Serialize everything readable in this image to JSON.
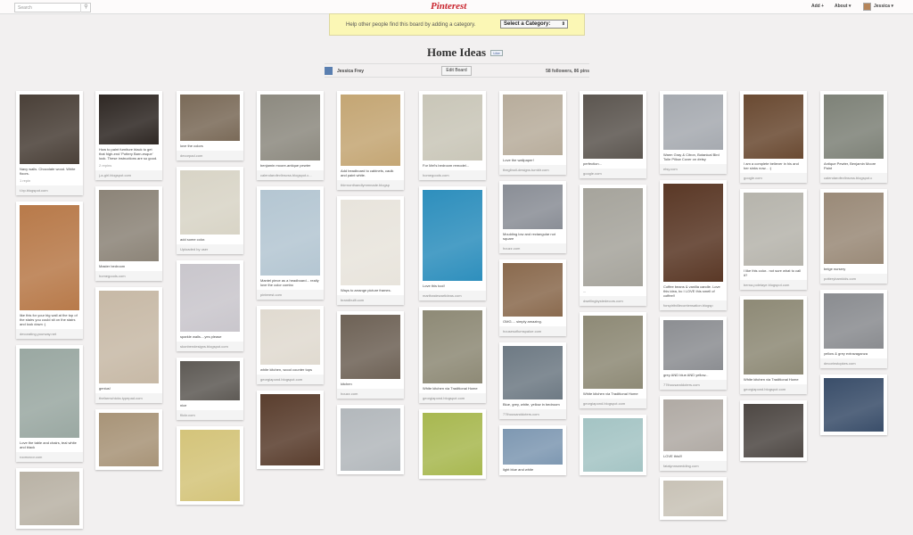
{
  "header": {
    "search_placeholder": "Search",
    "search_icon": "magnifier-icon",
    "logo": "Pinterest",
    "add_label": "Add +",
    "about_label": "About ▾",
    "user_label": "Jessica ▾"
  },
  "banner": {
    "text": "Help other people find this board by adding a category.",
    "select_value": "Select a Category:"
  },
  "board": {
    "title": "Home Ideas",
    "like_label": "Like",
    "owner": "Jessica Frey",
    "edit_label": "Edit Board",
    "stats": "58 followers, 86 pins"
  },
  "colors": {
    "brand": "#c8232c",
    "banner": "#fbf7b5"
  },
  "columns": [
    {
      "pins": [
        {
          "desc": "Navy walls. Chocolate wood. White floors.",
          "meta": "1 repin",
          "src": "t.bp.blogspot.com",
          "color": "#4a4038"
        },
        {
          "desc": "like this for your big wall at the top of the stairs you could sit on the stairs and look down :)",
          "meta": "",
          "src": "decorating.yourway.net",
          "color": "#b87a4a"
        },
        {
          "desc": "Love the table and chairs, teal white and black",
          "meta": "",
          "src": "roomzoor.com",
          "color": "#9aa8a2"
        },
        {
          "desc": "",
          "meta": "",
          "src": "",
          "color": "#b9b2a5"
        }
      ]
    },
    {
      "pins": [
        {
          "desc": "How to paint furniture black to get that high-end 'Pottery Barn-esque' look. These instructions are so good.",
          "meta": "2 repins",
          "src": "j-a-girl.blogspot.com",
          "color": "#2f2824"
        },
        {
          "desc": "Master bedroom",
          "meta": "",
          "src": "homegoods.com",
          "color": "#8c8478"
        },
        {
          "desc": "genius!",
          "meta": "",
          "src": "thefarmchicks.typepad.com",
          "color": "#c7b9a6"
        },
        {
          "desc": "",
          "meta": "",
          "src": "",
          "color": "#a89478"
        }
      ]
    },
    {
      "pins": [
        {
          "desc": "love the colors",
          "meta": "",
          "src": "decorpad.com",
          "color": "#7a6a58"
        },
        {
          "desc": "add some color.",
          "meta": "",
          "src": "Uploaded by user",
          "color": "#d8d4c6"
        },
        {
          "desc": "sparkle walls....yes please",
          "meta": "",
          "src": "skonbendesigns.blogspot.com",
          "color": "#c9c6cc"
        },
        {
          "desc": "nice",
          "meta": "",
          "src": "flickr.com",
          "color": "#5e5a55"
        },
        {
          "desc": "",
          "meta": "",
          "src": "",
          "color": "#d4c47a"
        }
      ]
    },
    {
      "pins": [
        {
          "desc": "benjamin moore-antique pewter",
          "meta": "",
          "src": "calendarofevlinsvss.blogspot.c...",
          "color": "#8d8a80"
        },
        {
          "desc": "Mantel piece as a headboard... really love the color combo",
          "meta": "",
          "src": "pinterest.com",
          "color": "#b4c6d2"
        },
        {
          "desc": "white kitchen, wood counter tops",
          "meta": "",
          "src": "georgiapond.blogspot.com",
          "color": "#e0dad0"
        },
        {
          "desc": "",
          "meta": "",
          "src": "",
          "color": "#5a3e2e"
        }
      ]
    },
    {
      "pins": [
        {
          "desc": "Add beadboard to cabinets, caulk and paint white.",
          "meta": "",
          "src": "thirrnonthandlymmnade.blogsp",
          "color": "#c4a674"
        },
        {
          "desc": "Ways to arrange picture frames.",
          "meta": "",
          "src": "brandbuilt.com",
          "color": "#e8e4dc"
        },
        {
          "desc": "kitchen",
          "meta": "",
          "src": "houzz.com",
          "color": "#6e6256"
        },
        {
          "desc": "",
          "meta": "",
          "src": "",
          "color": "#b3b8bc"
        }
      ]
    },
    {
      "pins": [
        {
          "desc": "For Mel's bedroom remodel...",
          "meta": "",
          "src": "homegoods.com",
          "color": "#c9c6b8"
        },
        {
          "desc": "Love this tool!",
          "meta": "",
          "src": "marthastewartideas.com",
          "color": "#2e8fbd"
        },
        {
          "desc": "White kitchen via Traditional Home",
          "meta": "",
          "src": "georgiapond.blogspot.com",
          "color": "#8e8a76"
        },
        {
          "desc": "",
          "meta": "",
          "src": "",
          "color": "#a8b850"
        }
      ]
    },
    {
      "pins": [
        {
          "desc": "Love the wallpaper!",
          "meta": "",
          "src": "theglinoil-designs.tumblr.com",
          "color": "#b8ad9c"
        },
        {
          "desc": "Moulding low and rectangular not square",
          "meta": "",
          "src": "houzz.com",
          "color": "#8a8e96"
        },
        {
          "desc": "OMG.... simply amazing.",
          "meta": "",
          "src": "housesoflumspaloe.com",
          "color": "#8a6a4e"
        },
        {
          "desc": "Blue, grey, white, yellow in bedroom",
          "meta": "",
          "src": "77thousanddoters.com",
          "color": "#6e7a84"
        },
        {
          "desc": "light blue and white",
          "meta": "",
          "src": "",
          "color": "#7e98b2"
        }
      ]
    },
    {
      "pins": [
        {
          "desc": "perfection...",
          "meta": "",
          "src": "google.com",
          "color": "#5c5650"
        },
        {
          "desc": "...",
          "meta": "",
          "src": "dwellingbystedecors.com",
          "color": "#a6a49c"
        },
        {
          "desc": "White kitchen via Traditional Home",
          "meta": "",
          "src": "georgiapond.blogspot.com",
          "color": "#8e8a76"
        },
        {
          "desc": "",
          "meta": "",
          "src": "",
          "color": "#a4c4c4"
        }
      ]
    },
    {
      "pins": [
        {
          "desc": "Warm Gray & Citron, Botanical Bird Toile Pillow Cover on #etsy",
          "meta": "",
          "src": "etsy.com",
          "color": "#a6aab0"
        },
        {
          "desc": "Coffee beans & vanilla candle. Love this idea, bc I LOVE this smell of coffee!!",
          "meta": "",
          "src": "forspiritvillecontensation.blogsp",
          "color": "#5a3826"
        },
        {
          "desc": "grey AND blue AND yellow...",
          "meta": "",
          "src": "77thousanddoters.com",
          "color": "#8c8e92"
        },
        {
          "desc": "LOVE this!!!",
          "meta": "",
          "src": "fatalynnswedding.com",
          "color": "#b0aaa4"
        },
        {
          "desc": "",
          "meta": "",
          "src": "",
          "color": "#c8c2b6"
        }
      ]
    },
    {
      "pins": [
        {
          "desc": "I am a complete believer in his and her sinks now... :)",
          "meta": "",
          "src": "google.com",
          "color": "#6a4a32"
        },
        {
          "desc": "I like this color.. not sure what to call it?",
          "meta": "",
          "src": "berna.poletaye.blogspot.com",
          "color": "#b6b4ac"
        },
        {
          "desc": "White kitchen via Traditional Home",
          "meta": "",
          "src": "georgiapond.blogspot.com",
          "color": "#8e8a76"
        },
        {
          "desc": "",
          "meta": "",
          "src": "",
          "color": "#4e4844"
        }
      ]
    },
    {
      "pins": [
        {
          "desc": "Antique Pewter, Benjamin Moore Paint",
          "meta": "",
          "src": "calendarofevlinsvss.blogspot.c",
          "color": "#7e8278"
        },
        {
          "desc": "beige nursery",
          "meta": "",
          "src": "potterybarnkids.com",
          "color": "#9a8a78"
        },
        {
          "desc": "yellow & grey extravaganza",
          "meta": "",
          "src": "decorinstopkes.com",
          "color": "#8a8c90"
        },
        {
          "desc": "",
          "meta": "",
          "src": "",
          "color": "#3a4e6a"
        }
      ]
    }
  ]
}
